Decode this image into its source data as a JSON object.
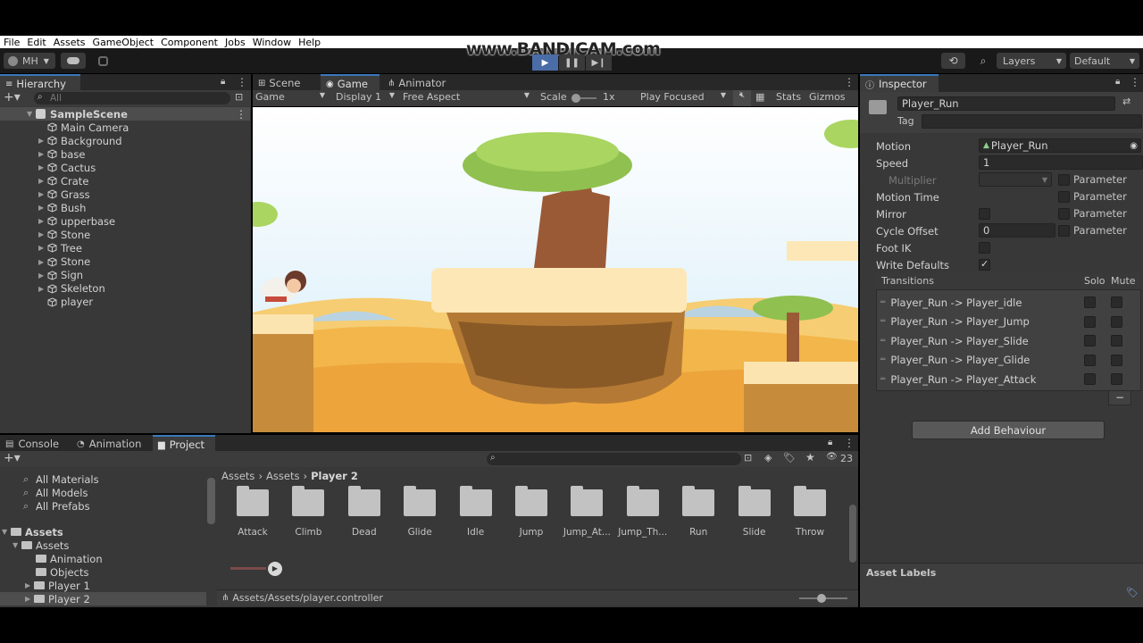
{
  "watermark": "www.BANDICAM.com",
  "menu": [
    "File",
    "Edit",
    "Assets",
    "GameObject",
    "Component",
    "Jobs",
    "Window",
    "Help"
  ],
  "toolbar": {
    "account": "MH",
    "layers": "Layers",
    "layout": "Default"
  },
  "hierarchy": {
    "tab": "Hierarchy",
    "search_placeholder": "All",
    "scene": "SampleScene",
    "items": [
      "Main Camera",
      "Background",
      "base",
      "Cactus",
      "Crate",
      "Grass",
      "Bush",
      "upperbase",
      "Stone",
      "Tree",
      "Stone",
      "Sign",
      "Skeleton",
      "player"
    ]
  },
  "center_tabs": [
    "Scene",
    "Game",
    "Animator"
  ],
  "game_bar": {
    "mode": "Game",
    "display": "Display 1",
    "aspect": "Free Aspect",
    "scale_label": "Scale",
    "scale_value": "1x",
    "play_mode": "Play Focused",
    "stats": "Stats",
    "gizmos": "Gizmos"
  },
  "inspector": {
    "tab": "Inspector",
    "name": "Player_Run",
    "tag_label": "Tag",
    "rows": {
      "motion_label": "Motion",
      "motion_value": "Player_Run",
      "speed_label": "Speed",
      "speed_value": "1",
      "multiplier_label": "Multiplier",
      "motion_time_label": "Motion Time",
      "mirror_label": "Mirror",
      "cycle_offset_label": "Cycle Offset",
      "cycle_offset_value": "0",
      "foot_ik_label": "Foot IK",
      "write_defaults_label": "Write Defaults",
      "parameter_label": "Parameter"
    },
    "transitions_title": "Transitions",
    "solo": "Solo",
    "mute": "Mute",
    "transitions": [
      "Player_Run -> Player_idle",
      "Player_Run -> Player_Jump",
      "Player_Run -> Player_Slide",
      "Player_Run -> Player_Glide",
      "Player_Run -> Player_Attack"
    ],
    "remove": "−",
    "add_behaviour": "Add Behaviour",
    "asset_labels": "Asset Labels"
  },
  "bottom_tabs": [
    "Console",
    "Animation",
    "Project"
  ],
  "project": {
    "favorites": [
      "All Materials",
      "All Models",
      "All Prefabs"
    ],
    "assets_root": "Assets",
    "assets_child": "Assets",
    "subfolders": [
      "Animation",
      "Objects",
      "Player 1",
      "Player 2"
    ],
    "breadcrumb": [
      "Assets",
      "Assets",
      "Player 2"
    ],
    "hidden_count": "23",
    "folders": [
      "Attack",
      "Climb",
      "Dead",
      "Glide",
      "Idle",
      "Jump",
      "Jump_At...",
      "Jump_Th...",
      "Run",
      "Slide",
      "Throw"
    ],
    "path": "Assets/Assets/player.controller"
  },
  "colors": {
    "accent": "#3a79bb",
    "panel": "#383838",
    "sky": "#e6f4fb",
    "sand": "#f1b54a"
  }
}
